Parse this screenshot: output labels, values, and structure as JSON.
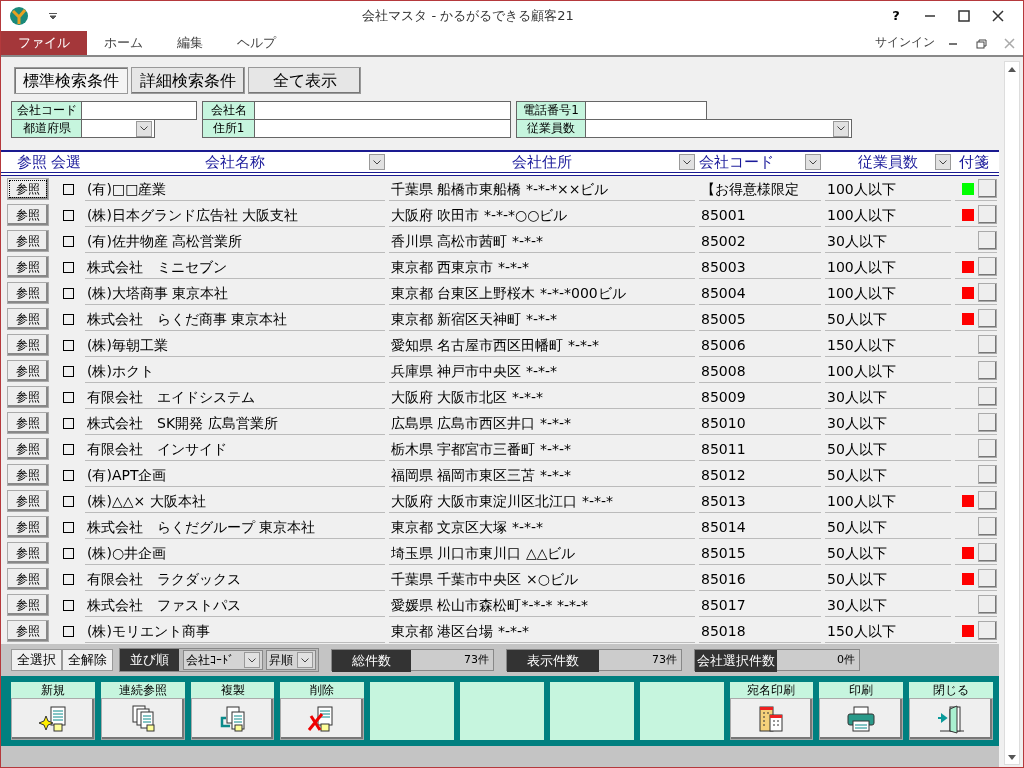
{
  "window": {
    "title": "会社マスタ - かるがるできる顧客21",
    "help": "?",
    "signin": "サインイン"
  },
  "menu": [
    {
      "label": "ファイル",
      "selected": true
    },
    {
      "label": "ホーム",
      "selected": false
    },
    {
      "label": "編集",
      "selected": false
    },
    {
      "label": "ヘルプ",
      "selected": false
    }
  ],
  "search_tabs": [
    {
      "label": "標準検索条件",
      "selected": true
    },
    {
      "label": "詳細検索条件",
      "selected": false
    }
  ],
  "show_all_button": "全て表示",
  "search_fields": [
    [
      {
        "label": "会社コード",
        "kind": "text"
      },
      {
        "label": "都道府県",
        "kind": "select"
      }
    ],
    [
      {
        "label": "会社名",
        "kind": "text"
      },
      {
        "label": "住所1",
        "kind": "text"
      }
    ],
    [
      {
        "label": "電話番号1",
        "kind": "text"
      },
      {
        "label": "従業員数",
        "kind": "select"
      }
    ]
  ],
  "table": {
    "columns": [
      {
        "label": "参照",
        "filter": false
      },
      {
        "label": "会選",
        "filter": false
      },
      {
        "label": "会社名称",
        "filter": true
      },
      {
        "label": "会社住所",
        "filter": true
      },
      {
        "label": "会社コード",
        "filter": true
      },
      {
        "label": "従業員数",
        "filter": true
      },
      {
        "label": "付箋",
        "filter": false
      }
    ],
    "rows": [
      {
        "button": "参照",
        "focused": true,
        "checked": false,
        "name": "(有)□□産業",
        "address": "千葉県 船橋市東船橋 *-*-*××ビル",
        "code": "【お得意様限定",
        "employees": "100人以下",
        "color": "#00ff00"
      },
      {
        "button": "参照",
        "focused": false,
        "checked": false,
        "name": "(株)日本グランド広告社 大阪支社",
        "address": "大阪府 吹田市 *-*-*○○ビル",
        "code": "85001",
        "employees": "100人以下",
        "color": "#ff0000"
      },
      {
        "button": "参照",
        "focused": false,
        "checked": false,
        "name": "(有)佐井物産 高松営業所",
        "address": "香川県 高松市茜町 *-*-*",
        "code": "85002",
        "employees": "30人以下"
      },
      {
        "button": "参照",
        "focused": false,
        "checked": false,
        "name": "株式会社　ミニセブン",
        "address": "東京都 西東京市 *-*-*",
        "code": "85003",
        "employees": "100人以下",
        "color": "#ff0000"
      },
      {
        "button": "参照",
        "focused": false,
        "checked": false,
        "name": "(株)大塔商事 東京本社",
        "address": "東京都 台東区上野桜木 *-*-*000ビル",
        "code": "85004",
        "employees": "100人以下",
        "color": "#ff0000"
      },
      {
        "button": "参照",
        "focused": false,
        "checked": false,
        "name": "株式会社　らくだ商事 東京本社",
        "address": "東京都 新宿区天神町 *-*-*",
        "code": "85005",
        "employees": "50人以下",
        "color": "#ff0000"
      },
      {
        "button": "参照",
        "focused": false,
        "checked": false,
        "name": "(株)毎朝工業",
        "address": "愛知県 名古屋市西区田幡町 *-*-*",
        "code": "85006",
        "employees": "150人以下"
      },
      {
        "button": "参照",
        "focused": false,
        "checked": false,
        "name": "(株)ホクト",
        "address": "兵庫県 神戸市中央区 *-*-*",
        "code": "85008",
        "employees": "100人以下"
      },
      {
        "button": "参照",
        "focused": false,
        "checked": false,
        "name": "有限会社　エイドシステム",
        "address": "大阪府 大阪市北区 *-*-*",
        "code": "85009",
        "employees": "30人以下"
      },
      {
        "button": "参照",
        "focused": false,
        "checked": false,
        "name": "株式会社　SK開発 広島営業所",
        "address": "広島県 広島市西区井口 *-*-*",
        "code": "85010",
        "employees": "30人以下"
      },
      {
        "button": "参照",
        "focused": false,
        "checked": false,
        "name": "有限会社　インサイド",
        "address": "栃木県 宇都宮市三番町 *-*-*",
        "code": "85011",
        "employees": "50人以下"
      },
      {
        "button": "参照",
        "focused": false,
        "checked": false,
        "name": "(有)APT企画",
        "address": "福岡県 福岡市東区三苫 *-*-*",
        "code": "85012",
        "employees": "50人以下"
      },
      {
        "button": "参照",
        "focused": false,
        "checked": false,
        "name": "(株)△△× 大阪本社",
        "address": "大阪府 大阪市東淀川区北江口 *-*-*",
        "code": "85013",
        "employees": "100人以下",
        "color": "#ff0000"
      },
      {
        "button": "参照",
        "focused": false,
        "checked": false,
        "name": "株式会社　らくだグループ 東京本社",
        "address": "東京都 文京区大塚 *-*-*",
        "code": "85014",
        "employees": "50人以下"
      },
      {
        "button": "参照",
        "focused": false,
        "checked": false,
        "name": "(株)○井企画",
        "address": "埼玉県 川口市東川口 △△ビル",
        "code": "85015",
        "employees": "50人以下",
        "color": "#ff0000"
      },
      {
        "button": "参照",
        "focused": false,
        "checked": false,
        "name": "有限会社　ラクダックス",
        "address": "千葉県 千葉市中央区 ×○ビル",
        "code": "85016",
        "employees": "50人以下",
        "color": "#ff0000"
      },
      {
        "button": "参照",
        "focused": false,
        "checked": false,
        "name": "株式会社　ファストパス",
        "address": "愛媛県 松山市森松町*-*-* *-*-*",
        "code": "85017",
        "employees": "30人以下"
      },
      {
        "button": "参照",
        "focused": false,
        "checked": false,
        "name": "(株)モリエント商事",
        "address": "東京都 港区台場 *-*-*",
        "code": "85018",
        "employees": "150人以下",
        "color": "#ff0000"
      }
    ]
  },
  "footer": {
    "select_all": "全選択",
    "deselect_all": "全解除",
    "sort_label": "並び順",
    "sort_field": "会社ｺｰﾄﾞ",
    "sort_order": "昇順",
    "counters": [
      {
        "label": "総件数",
        "value": "73件"
      },
      {
        "label": "表示件数",
        "value": "73件"
      },
      {
        "label": "会社選択件数",
        "value": "0件"
      }
    ]
  },
  "actions": [
    {
      "kind": "new",
      "label": "新規"
    },
    {
      "kind": "series",
      "label": "連続参照"
    },
    {
      "kind": "copy",
      "label": "複製"
    },
    {
      "kind": "delete",
      "label": "削除"
    },
    {
      "kind": "empty"
    },
    {
      "kind": "empty"
    },
    {
      "kind": "empty"
    },
    {
      "kind": "empty"
    },
    {
      "kind": "address",
      "label": "宛名印刷"
    },
    {
      "kind": "print",
      "label": "印刷"
    },
    {
      "kind": "close",
      "label": "閉じる"
    }
  ]
}
